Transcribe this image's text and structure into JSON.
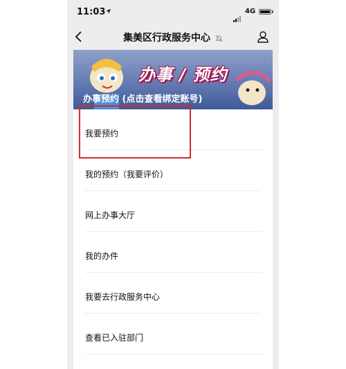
{
  "status_bar": {
    "time": "11:03",
    "network": "4G"
  },
  "nav": {
    "title": "集美区行政服务中心"
  },
  "banner": {
    "headline": "办事 / 预约",
    "caption": "办事预约 (点击查看绑定账号)"
  },
  "menu": {
    "items": [
      {
        "label": "我要预约"
      },
      {
        "label": "我的预约（我要评价）"
      },
      {
        "label": "网上办事大厅"
      },
      {
        "label": "我的办件"
      },
      {
        "label": "我要去行政服务中心"
      },
      {
        "label": "查看已入驻部门"
      }
    ]
  },
  "colors": {
    "highlight": "#d42a2a",
    "banner_text_outline": "#a0144f"
  }
}
